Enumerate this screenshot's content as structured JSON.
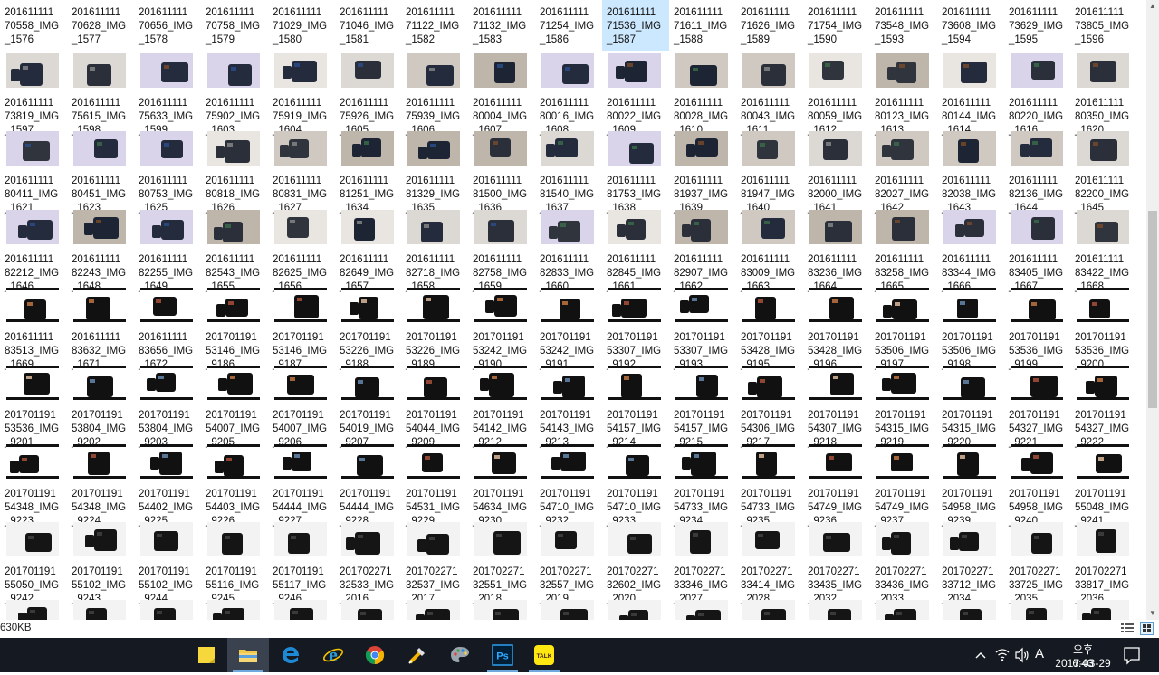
{
  "explorer": {
    "columns": 17,
    "rows": [
      {
        "thumbs": false,
        "items": [
          "201611111\n70558_IMG\n_1576",
          "201611111\n70628_IMG\n_1577",
          "201611111\n70656_IMG\n_1578",
          "201611111\n70758_IMG\n_1579",
          "201611111\n71029_IMG\n_1580",
          "201611111\n71046_IMG\n_1581",
          "201611111\n71122_IMG\n_1582",
          "201611111\n71132_IMG\n_1583",
          "201611111\n71254_IMG\n_1586",
          "201611111\n71536_IMG\n_1587",
          "201611111\n71611_IMG\n_1588",
          "201611111\n71626_IMG\n_1589",
          "201611111\n71754_IMG\n_1590",
          "201611111\n73548_IMG\n_1593",
          "201611111\n73608_IMG\n_1594",
          "201611111\n73629_IMG\n_1595",
          "201611111\n73805_IMG\n_1596"
        ]
      },
      {
        "thumbs": true,
        "items": [
          "201611111\n73819_IMG\n_1597",
          "201611111\n75615_IMG\n_1598",
          "201611111\n75633_IMG\n_1599",
          "201611111\n75902_IMG\n_1603",
          "201611111\n75919_IMG\n_1604",
          "201611111\n75926_IMG\n_1605",
          "201611111\n75939_IMG\n_1606",
          "201611111\n80004_IMG\n_1607",
          "201611111\n80016_IMG\n_1608",
          "201611111\n80022_IMG\n_1609",
          "201611111\n80028_IMG\n_1610",
          "201611111\n80043_IMG\n_1611",
          "201611111\n80059_IMG\n_1612",
          "201611111\n80123_IMG\n_1613",
          "201611111\n80144_IMG\n_1614",
          "201611111\n80220_IMG\n_1616",
          "201611111\n80350_IMG\n_1620"
        ]
      },
      {
        "thumbs": true,
        "items": [
          "201611111\n80411_IMG\n_1621",
          "201611111\n80451_IMG\n_1623",
          "201611111\n80753_IMG\n_1625",
          "201611111\n80818_IMG\n_1626",
          "201611111\n80831_IMG\n_1627",
          "201611111\n81251_IMG\n_1634",
          "201611111\n81329_IMG\n_1635",
          "201611111\n81500_IMG\n_1636",
          "201611111\n81540_IMG\n_1637",
          "201611111\n81753_IMG\n_1638",
          "201611111\n81937_IMG\n_1639",
          "201611111\n81947_IMG\n_1640",
          "201611111\n82000_IMG\n_1641",
          "201611111\n82027_IMG\n_1642",
          "201611111\n82038_IMG\n_1643",
          "201611111\n82136_IMG\n_1644",
          "201611111\n82200_IMG\n_1645"
        ]
      },
      {
        "thumbs": true,
        "items": [
          "201611111\n82212_IMG\n_1646",
          "201611111\n82243_IMG\n_1648",
          "201611111\n82255_IMG\n_1649",
          "201611111\n82543_IMG\n_1655",
          "201611111\n82625_IMG\n_1656",
          "201611111\n82649_IMG\n_1657",
          "201611111\n82718_IMG\n_1658",
          "201611111\n82758_IMG\n_1659",
          "201611111\n82833_IMG\n_1660",
          "201611111\n82845_IMG\n_1661",
          "201611111\n82907_IMG\n_1662",
          "201611111\n83009_IMG\n_1663",
          "201611111\n83236_IMG\n_1664",
          "201611111\n83258_IMG\n_1665",
          "201611111\n83344_IMG\n_1666",
          "201611111\n83405_IMG\n_1667",
          "201611111\n83422_IMG\n_1668"
        ]
      },
      {
        "thumbs": true,
        "items": [
          "201611111\n83513_IMG\n_1669",
          "201611111\n83632_IMG\n_1671",
          "201611111\n83656_IMG\n_1672",
          "201701191\n53146_IMG\n_9186",
          "201701191\n53146_IMG\n_9187",
          "201701191\n53226_IMG\n_9188",
          "201701191\n53226_IMG\n_9189",
          "201701191\n53242_IMG\n_9190",
          "201701191\n53242_IMG\n_9191",
          "201701191\n53307_IMG\n_9192",
          "201701191\n53307_IMG\n_9193",
          "201701191\n53428_IMG\n_9195",
          "201701191\n53428_IMG\n_9196",
          "201701191\n53506_IMG\n_9197",
          "201701191\n53506_IMG\n_9198",
          "201701191\n53536_IMG\n_9199",
          "201701191\n53536_IMG\n_9200"
        ]
      },
      {
        "thumbs": true,
        "items": [
          "201701191\n53536_IMG\n_9201",
          "201701191\n53804_IMG\n_9202",
          "201701191\n53804_IMG\n_9203",
          "201701191\n54007_IMG\n_9205",
          "201701191\n54007_IMG\n_9206",
          "201701191\n54019_IMG\n_9207",
          "201701191\n54044_IMG\n_9209",
          "201701191\n54142_IMG\n_9212",
          "201701191\n54143_IMG\n_9213",
          "201701191\n54157_IMG\n_9214",
          "201701191\n54157_IMG\n_9215",
          "201701191\n54306_IMG\n_9217",
          "201701191\n54307_IMG\n_9218",
          "201701191\n54315_IMG\n_9219",
          "201701191\n54315_IMG\n_9220",
          "201701191\n54327_IMG\n_9221",
          "201701191\n54327_IMG\n_9222"
        ]
      },
      {
        "thumbs": true,
        "items": [
          "201701191\n54348_IMG\n_9223",
          "201701191\n54348_IMG\n_9224",
          "201701191\n54402_IMG\n_9225",
          "201701191\n54403_IMG\n_9226",
          "201701191\n54444_IMG\n_9227",
          "201701191\n54444_IMG\n_9228",
          "201701191\n54531_IMG\n_9229",
          "201701191\n54634_IMG\n_9230",
          "201701191\n54710_IMG\n_9232",
          "201701191\n54710_IMG\n_9233",
          "201701191\n54733_IMG\n_9234",
          "201701191\n54733_IMG\n_9235",
          "201701191\n54749_IMG\n_9236",
          "201701191\n54749_IMG\n_9237",
          "201701191\n54958_IMG\n_9239",
          "201701191\n54958_IMG\n_9240",
          "201701191\n55048_IMG\n_9241"
        ]
      },
      {
        "thumbs": true,
        "items": [
          "201701191\n55050_IMG\n_9242",
          "201701191\n55102_IMG\n_9243",
          "201701191\n55102_IMG\n_9244",
          "201701191\n55116_IMG\n_9245",
          "201701191\n55117_IMG\n_9246",
          "201702271\n32533_IMG\n_2016",
          "201702271\n32537_IMG\n_2017",
          "201702271\n32551_IMG\n_2018",
          "201702271\n32557_IMG\n_2019",
          "201702271\n32602_IMG\n_2020",
          "201702271\n33346_IMG\n_2027",
          "201702271\n33414_IMG\n_2028",
          "201702271\n33435_IMG\n_2032",
          "201702271\n33436_IMG\n_2033",
          "201702271\n33712_IMG\n_2034",
          "201702271\n33725_IMG\n_2035",
          "201702271\n33817_IMG\n_2036"
        ]
      },
      {
        "thumbs": true,
        "items": [
          "",
          "",
          "",
          "",
          "",
          "",
          "",
          "",
          "",
          "",
          "",
          "",
          "",
          "",
          "",
          "",
          ""
        ]
      }
    ],
    "selected_item": "201611111\n71536_IMG\n_1587",
    "selection_color": "#cce8ff"
  },
  "statusbar": {
    "size_text": "630KB",
    "details_view_icon": "details-view-icon",
    "tiles_view_icon": "large-icons-view-icon"
  },
  "taskbar": {
    "background": "#151a22",
    "apps": [
      {
        "name": "sticky-notes",
        "icon": "sticky-notes-icon",
        "color": "#f6d83d",
        "running": false
      },
      {
        "name": "file-explorer",
        "icon": "folder-icon",
        "color": "#f2c94c",
        "running": true,
        "active": true
      },
      {
        "name": "edge",
        "icon": "edge-icon",
        "color": "#1e8ad6",
        "running": false
      },
      {
        "name": "internet-explorer",
        "icon": "internet-explorer-icon",
        "color": "#2b9bd8",
        "running": false
      },
      {
        "name": "chrome",
        "icon": "chrome-icon",
        "color": "#4285f4",
        "running": false
      },
      {
        "name": "app-6",
        "icon": "tool-icon",
        "color": "#f5b400",
        "running": false
      },
      {
        "name": "paint",
        "icon": "palette-icon",
        "color": "#9aa4ad",
        "running": false
      },
      {
        "name": "photoshop",
        "icon": "photoshop-icon",
        "color": "#31a8ff",
        "running": true,
        "label": "Ps"
      },
      {
        "name": "kakaotalk",
        "icon": "kakaotalk-icon",
        "color": "#ffe812",
        "running": true,
        "label": "TALK"
      }
    ],
    "tray": {
      "ime": "A",
      "time": "오후 6:43",
      "date": "2017-03-29"
    }
  }
}
